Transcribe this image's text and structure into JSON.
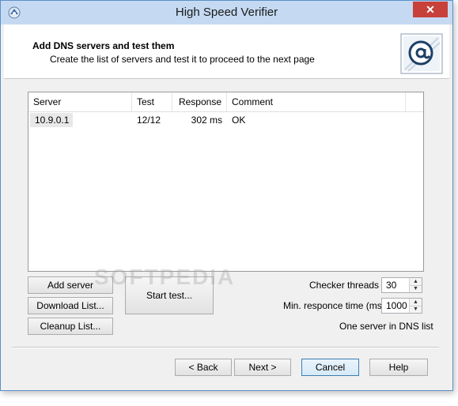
{
  "window": {
    "title": "High Speed Verifier",
    "close_glyph": "✕"
  },
  "header": {
    "title": "Add DNS servers and test them",
    "subtitle": "Create the list of servers and test it to proceed to the next page",
    "logo_icon": "email-at-icon"
  },
  "list": {
    "columns": [
      "Server",
      "Test",
      "Response",
      "Comment"
    ],
    "rows": [
      {
        "server": "10.9.0.1",
        "test": "12/12",
        "response": "302 ms",
        "comment": "OK"
      }
    ]
  },
  "buttons": {
    "add_server": "Add server",
    "download_list": "Download List...",
    "cleanup_list": "Cleanup List...",
    "start_test": "Start test..."
  },
  "settings": {
    "threads_label": "Checker threads :",
    "threads_value": "30",
    "min_response_label": "Min. responce time (ms):",
    "min_response_value": "1000",
    "status": "One server in DNS list"
  },
  "nav": {
    "back": "< Back",
    "next": "Next >",
    "cancel": "Cancel",
    "help": "Help"
  },
  "watermark": "SOFTPEDIA"
}
